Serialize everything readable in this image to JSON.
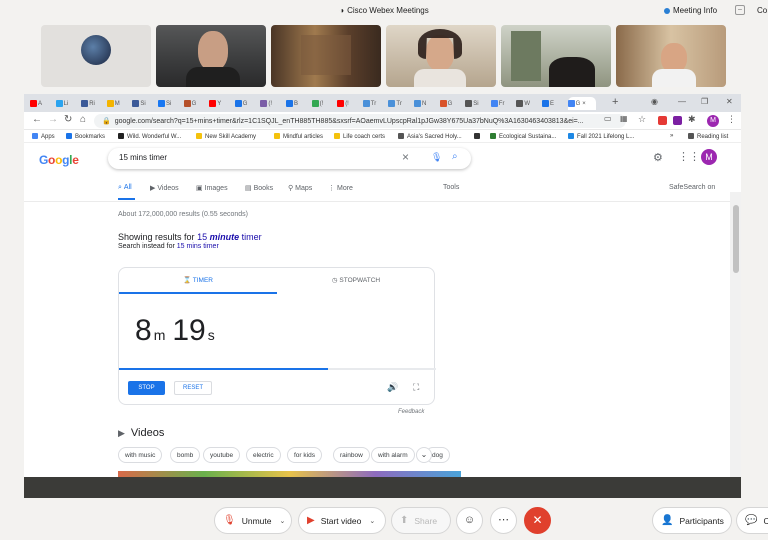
{
  "webex": {
    "title": "Cisco Webex Meetings",
    "meeting_info": "Meeting Info",
    "right_cut": "Co",
    "controls": {
      "unmute": "Unmute",
      "start_video": "Start video",
      "share": "Share",
      "participants": "Participants",
      "chat": "Ch"
    }
  },
  "browser": {
    "tabs": [
      {
        "label": "A",
        "color": "#ff0000"
      },
      {
        "label": "Li",
        "color": "#2aa3ef"
      },
      {
        "label": "Ri",
        "color": "#3b5998"
      },
      {
        "label": "M",
        "color": "#f4b400"
      },
      {
        "label": "Si",
        "color": "#3b5998"
      },
      {
        "label": "Si",
        "color": "#1877f2"
      },
      {
        "label": "G",
        "color": "#b5502a"
      },
      {
        "label": "Y",
        "color": "#ff0000"
      },
      {
        "label": "G",
        "color": "#1a73e8"
      },
      {
        "label": "(!",
        "color": "#7b5ea7"
      },
      {
        "label": "B",
        "color": "#1a73e8"
      },
      {
        "label": "(!",
        "color": "#34a853"
      },
      {
        "label": "(!",
        "color": "#ff0000"
      },
      {
        "label": "Tr",
        "color": "#4a90d9"
      },
      {
        "label": "Tr",
        "color": "#4a90d9"
      },
      {
        "label": "N",
        "color": "#4a90d9"
      },
      {
        "label": "G",
        "color": "#d9532a"
      },
      {
        "label": "Si",
        "color": "#555555"
      },
      {
        "label": "Fr",
        "color": "#4285f4"
      },
      {
        "label": "W",
        "color": "#555555"
      },
      {
        "label": "E",
        "color": "#1a73e8"
      },
      {
        "label": "G",
        "color": "#4285f4"
      }
    ],
    "active_tab_index": 21,
    "url": "google.com/search?q=15+mins+timer&rlz=1C1SQJL_enTH885TH885&oq=15+mins+timer&aqs=chrome..69i57j0l9.3463j0j7&sourceid=chrome&ie=UTF-8",
    "url_display": "google.com/search?q=15+mins+timer&rlz=1C1SQJL_enTH885TH885&sxsrf=AOaemvLUpscpRal1pJGw38Y675Ua37bNuQ%3A1630463403813&ei=...",
    "bookmarks": [
      {
        "label": "Apps",
        "color": "#4285f4"
      },
      {
        "label": "Bookmarks",
        "color": "#1a73e8"
      },
      {
        "label": "Wild. Wonderful W...",
        "color": "#222222"
      },
      {
        "label": "New Skill Academy",
        "color": "#f4c20d"
      },
      {
        "label": "Mindful articles",
        "color": "#f4c20d"
      },
      {
        "label": "Life coach certs",
        "color": "#f4c20d"
      },
      {
        "label": "Asia's Sacred Holy...",
        "color": "#555555"
      },
      {
        "label": "",
        "color": "#333333"
      },
      {
        "label": "Ecological Sustaina...",
        "color": "#2e7d32"
      },
      {
        "label": "Fall 2021 Lifelong L...",
        "color": "#1e88e5"
      }
    ],
    "reading_list": "Reading list",
    "more": "»"
  },
  "google": {
    "logo": "Google",
    "query": "15 mins timer",
    "tabs": [
      "All",
      "Videos",
      "Images",
      "Books",
      "Maps",
      "More"
    ],
    "tools": "Tools",
    "safesearch": "SafeSearch on",
    "stats": "About 172,000,000 results (0.55 seconds)",
    "showing_prefix": "Showing results for",
    "showing_num": "15",
    "showing_bold": "minute",
    "showing_suffix": "timer",
    "instead_prefix": "Search instead for",
    "instead_link": "15 mins timer",
    "avatar": "M",
    "timer": {
      "tab_timer": "TIMER",
      "tab_stopwatch": "STOPWATCH",
      "minutes": "8",
      "m_unit": "m",
      "seconds": "19",
      "s_unit": "s",
      "progress": 0.66,
      "stop": "STOP",
      "reset": "RESET",
      "feedback": "Feedback"
    },
    "videos_heading": "Videos",
    "video_chips": [
      "with music",
      "bomb",
      "youtube",
      "electric",
      "for kids",
      "rainbow",
      "with alarm",
      "dog"
    ]
  }
}
